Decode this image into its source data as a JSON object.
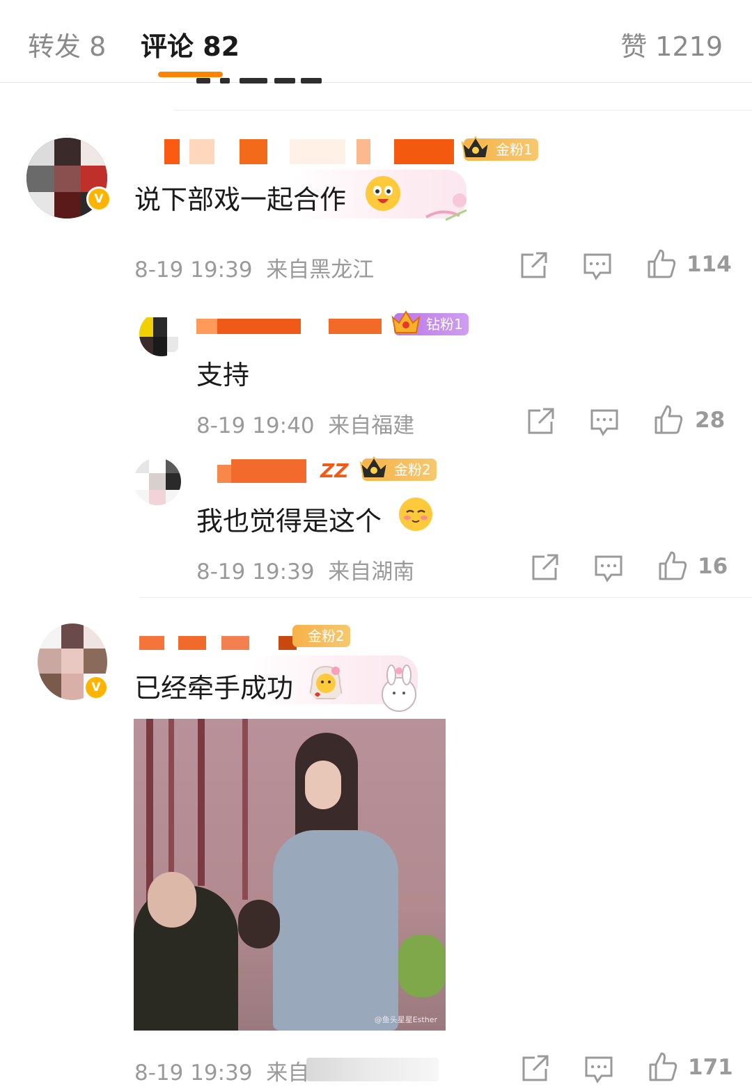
{
  "tabs": {
    "forward": "转发 8",
    "comments": "评论 82",
    "likes": "赞 1219"
  },
  "colors": {
    "accent": "#ff8200",
    "gold_badge": "#f7b24a",
    "diamond_badge": "#b979e5",
    "meta_gray": "#9a9a9a"
  },
  "comments": [
    {
      "fan_badge": "金粉1",
      "text": "说下部戏一起合作",
      "time": "8-19 19:39",
      "location": "来自黑龙江",
      "likes": "114"
    },
    {
      "fan_badge": "钻粉1",
      "text": "支持",
      "time": "8-19 19:40",
      "location": "来自福建",
      "likes": "28"
    },
    {
      "name_visible_fragment": "ZZ",
      "fan_badge": "金粉2",
      "text": "我也觉得是这个",
      "time": "8-19 19:39",
      "location": "来自湖南",
      "likes": "16"
    },
    {
      "fan_badge": "金粉2",
      "text": "已经牵手成功",
      "time": "8-19 19:39",
      "location": "来自",
      "likes": "171",
      "image_watermark": "@鱼头星星Esther"
    }
  ],
  "icons": [
    "share-icon",
    "comment-icon",
    "like-icon",
    "crown-icon",
    "verified-icon"
  ]
}
